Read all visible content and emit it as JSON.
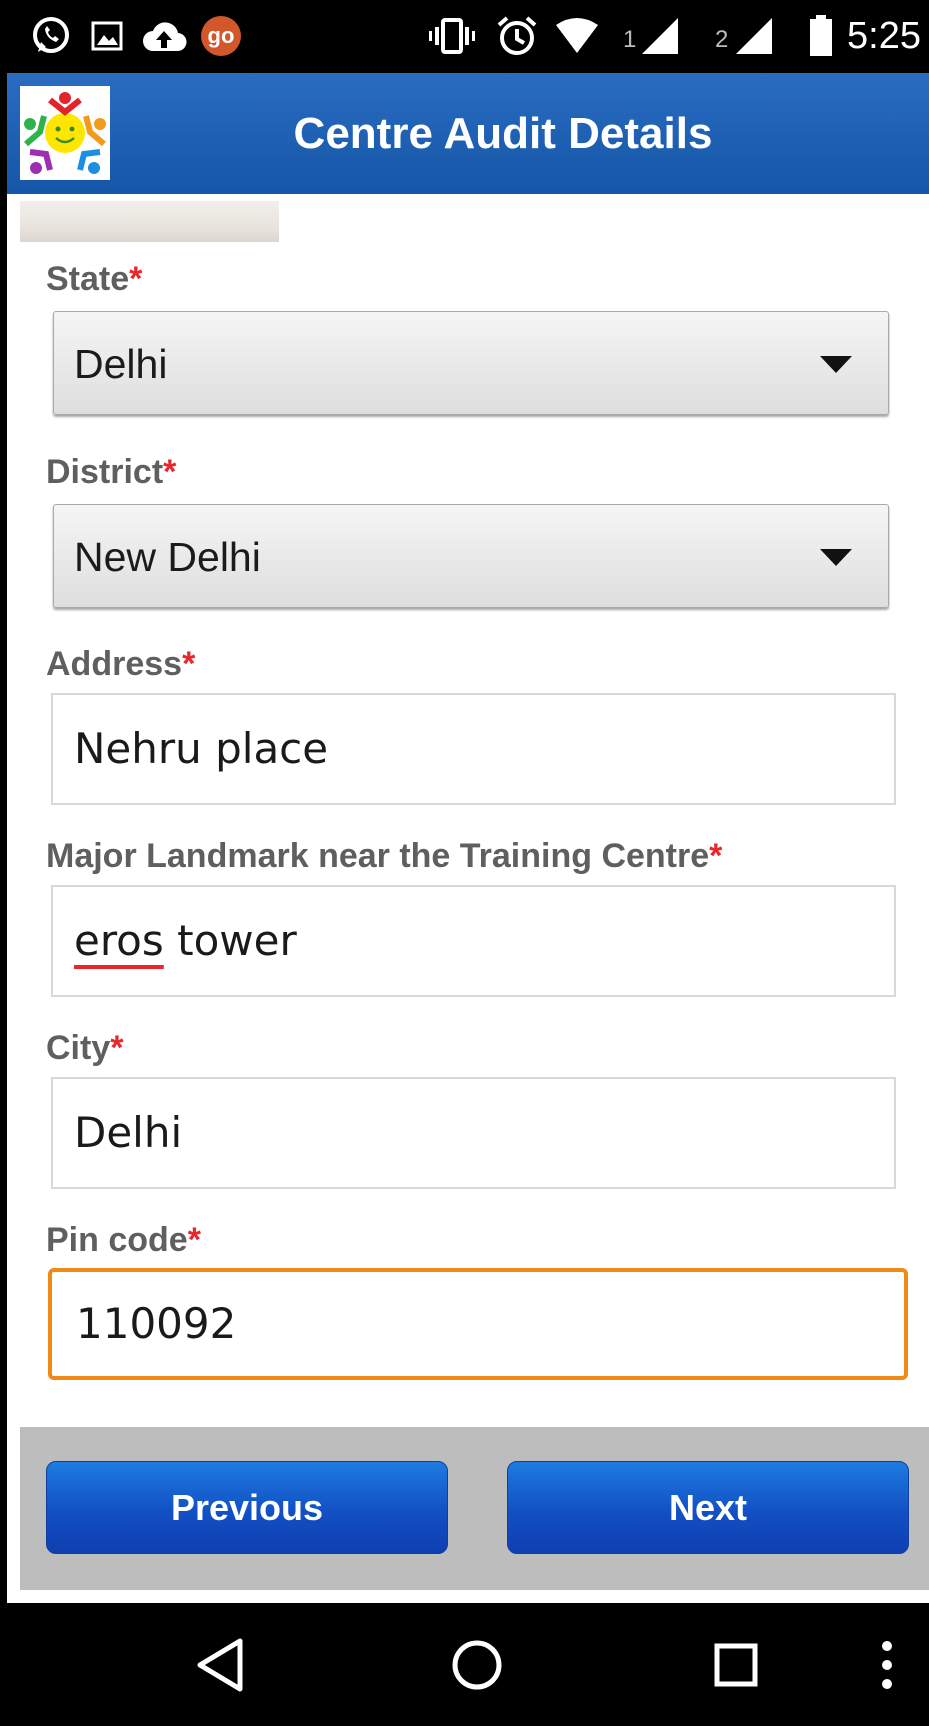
{
  "status_bar": {
    "time": "5:25",
    "sim1": "1",
    "sim2": "2",
    "icons": [
      "whatsapp-icon",
      "image-icon",
      "cloud-upload-icon",
      "go-icon",
      "vibrate-icon",
      "alarm-icon",
      "wifi-icon",
      "signal-icon",
      "signal-icon",
      "battery-icon"
    ],
    "go_badge": "go"
  },
  "app_bar": {
    "title": "Centre Audit Details",
    "logo": "smiley-people-logo"
  },
  "form": {
    "state": {
      "label": "State",
      "required": "*",
      "value": "Delhi"
    },
    "district": {
      "label": "District",
      "required": "*",
      "value": "New Delhi"
    },
    "address": {
      "label": "Address",
      "required": "*",
      "value": "Nehru place"
    },
    "landmark": {
      "label": "Major Landmark near the Training Centre",
      "required": "*",
      "value_misspelled": "eros",
      "value_rest": " tower"
    },
    "city": {
      "label": "City",
      "required": "*",
      "value": "Delhi"
    },
    "pincode": {
      "label": "Pin code",
      "required": "*",
      "value": "110092"
    }
  },
  "buttons": {
    "previous": "Previous",
    "next": "Next"
  },
  "colors": {
    "app_bar": "#1d5fb4",
    "required": "#e8262b",
    "focus_border": "#f08a17",
    "button": "#1556c8"
  },
  "nav_bar": {
    "icons": [
      "back-icon",
      "home-icon",
      "recents-icon",
      "more-icon"
    ]
  }
}
